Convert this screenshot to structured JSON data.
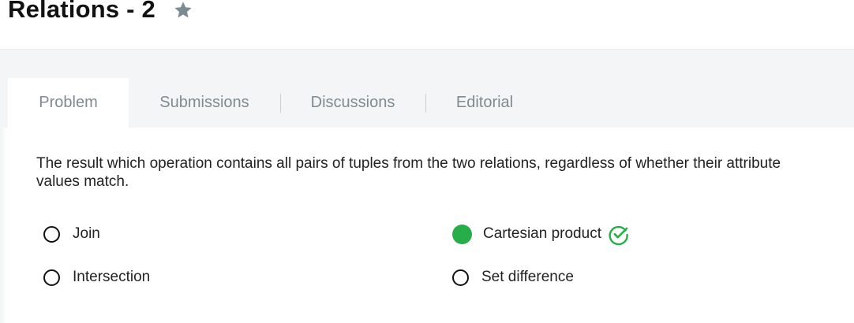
{
  "header": {
    "title": "Relations - 2",
    "star_icon": "star-icon"
  },
  "tabs": [
    {
      "label": "Problem",
      "active": true
    },
    {
      "label": "Submissions",
      "active": false
    },
    {
      "label": "Discussions",
      "active": false
    },
    {
      "label": "Editorial",
      "active": false
    }
  ],
  "question": {
    "text": "The result which operation contains all pairs of tuples from the two relations, regardless of whether their attribute values match."
  },
  "options": [
    {
      "label": "Join",
      "selected": false
    },
    {
      "label": "Cartesian product",
      "selected": true,
      "correct": true
    },
    {
      "label": "Intersection",
      "selected": false
    },
    {
      "label": "Set difference",
      "selected": false
    }
  ],
  "colors": {
    "selected": "#27ae4a",
    "tab_text": "#7f8b90",
    "star": "#7b8a93"
  }
}
